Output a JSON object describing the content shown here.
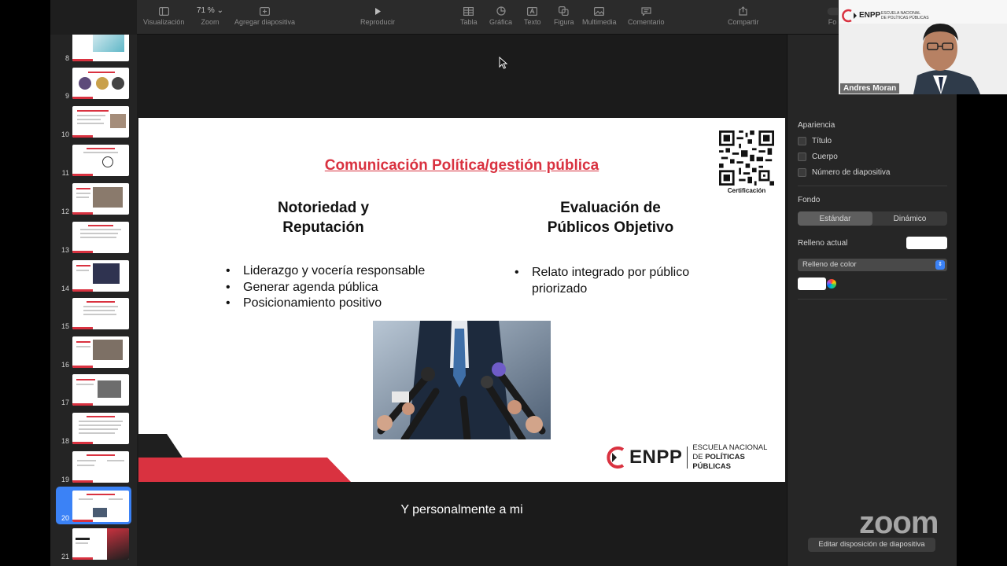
{
  "toolbar": {
    "zoom_value": "71 %",
    "items": {
      "view": "Visualización",
      "zoom": "Zoom",
      "add_slide": "Agregar diapositiva",
      "play": "Reproducir",
      "table": "Tabla",
      "chart": "Gráfica",
      "text": "Texto",
      "shape": "Figura",
      "media": "Multimedia",
      "comment": "Comentario",
      "share": "Compartir",
      "format_partial": "Fo"
    }
  },
  "sidebar": {
    "slide_numbers": [
      "8",
      "9",
      "10",
      "11",
      "12",
      "13",
      "14",
      "15",
      "16",
      "17",
      "18",
      "19",
      "20",
      "21"
    ],
    "selected": "20"
  },
  "slide": {
    "title": "Comunicación Política/gestión pública",
    "left_heading": "Notoriedad y\nReputación",
    "left_bullets": [
      "Liderazgo y vocería responsable",
      "Generar agenda pública",
      "Posicionamiento positivo"
    ],
    "right_heading": "Evaluación de\nPúblicos Objetivo",
    "right_bullets": [
      "Relato integrado por público priorizado"
    ],
    "qr_caption": "Certificación",
    "logo": {
      "wordmark": "ENPP",
      "line1": "ESCUELA NACIONAL",
      "line2_prefix": "DE ",
      "line2_bold": "POLÍTICAS PÚBLICAS"
    }
  },
  "caption": "Y personalmente a mi",
  "inspector": {
    "appearance_heading": "Apariencia",
    "checks": [
      "Título",
      "Cuerpo",
      "Número de diapositiva"
    ],
    "background_heading": "Fondo",
    "segments": [
      "Estándar",
      "Dinámico"
    ],
    "current_fill_label": "Relleno actual",
    "fill_type": "Relleno de color",
    "edit_layout_button": "Editar disposición de diapositiva"
  },
  "video": {
    "participant_name": "Andres Moran",
    "logo_text": "ENPP",
    "logo_sub1": "ESCUELA NACIONAL",
    "logo_sub2": "DE POLÍTICAS PÚBLICAS"
  },
  "zoom_watermark": "zoom",
  "colors": {
    "accent_red": "#d93240",
    "selection_blue": "#3b82f6",
    "toolbar_bg": "#2b2b2b",
    "panel_bg": "#262626"
  }
}
